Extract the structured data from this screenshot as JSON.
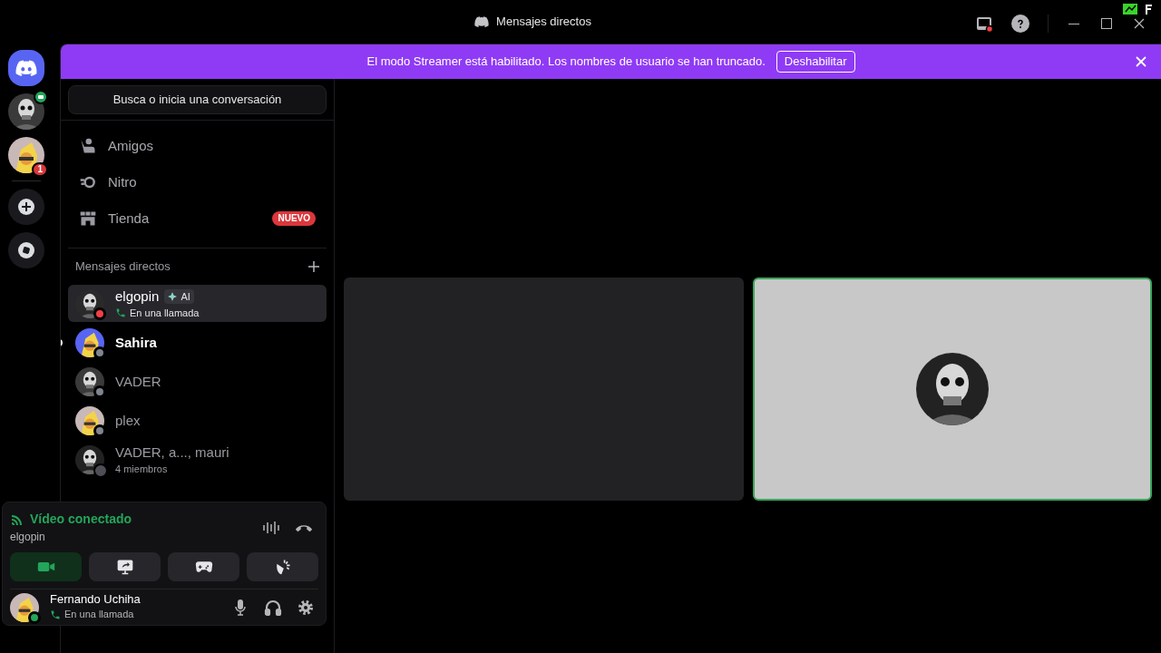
{
  "window": {
    "title": "Mensajes directos"
  },
  "banner": {
    "text": "El modo Streamer está habilitado. Los nombres de usuario se han truncado.",
    "button": "Deshabilitar"
  },
  "servers": [
    {
      "kind": "home",
      "selected": true
    },
    {
      "kind": "avatar",
      "video_call": true
    },
    {
      "kind": "avatar",
      "badge": "1"
    },
    {
      "kind": "separator"
    },
    {
      "kind": "add"
    },
    {
      "kind": "explore"
    }
  ],
  "search": {
    "placeholder": "Busca o inicia una conversación"
  },
  "nav": [
    {
      "kind": "friends",
      "label": "Amigos"
    },
    {
      "kind": "nitro",
      "label": "Nitro"
    },
    {
      "kind": "shop",
      "label": "Tienda",
      "badge": "NUEVO"
    }
  ],
  "dm_header": "Mensajes directos",
  "dms": [
    {
      "kind": "user",
      "name": "elgopin",
      "tag": "AI",
      "subtitle": "En una llamada",
      "color": "#f23f43",
      "selected": true,
      "unread": false
    },
    {
      "kind": "user",
      "name": "Sahira",
      "color": "#80848e",
      "selected": false,
      "unread": true
    },
    {
      "kind": "user",
      "name": "VADER",
      "color": "#80848e",
      "selected": false,
      "unread": false
    },
    {
      "kind": "user",
      "name": "plex",
      "color": "#80848e",
      "selected": false,
      "unread": false
    },
    {
      "kind": "group",
      "name": "VADER, a..., mauri",
      "subtitle": "4 miembros",
      "selected": false,
      "unread": false
    }
  ],
  "voice": {
    "status": "Vídeo conectado",
    "channel": "elgopin",
    "buttons": [
      {
        "kind": "camera",
        "on": true
      },
      {
        "kind": "screen",
        "on": false
      },
      {
        "kind": "activity",
        "on": false
      },
      {
        "kind": "soundboard",
        "on": false
      }
    ]
  },
  "user": {
    "name": "Fernando Uchiha",
    "subtitle": "En una llamada",
    "color": "#23a55a"
  },
  "tiles": [
    {
      "kind": "empty",
      "speaking": false
    },
    {
      "kind": "avatar",
      "speaking": true
    }
  ]
}
